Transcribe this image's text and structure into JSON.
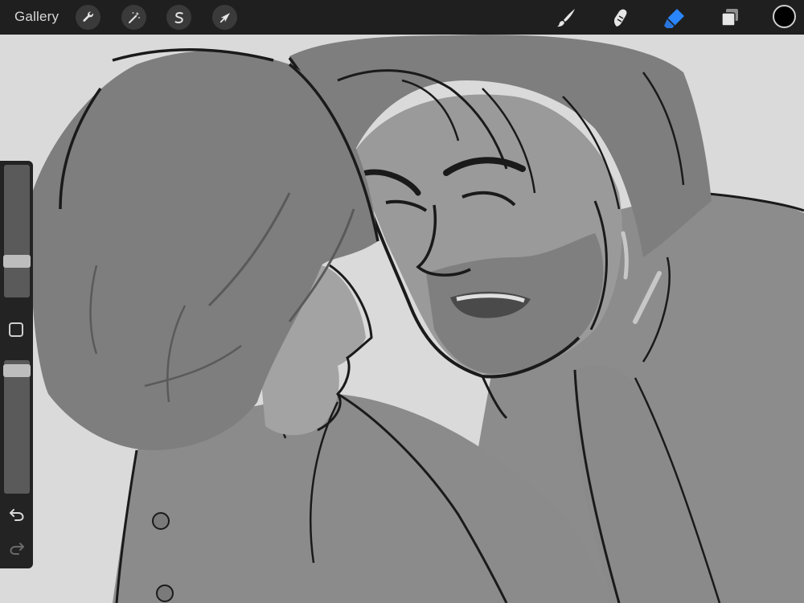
{
  "toolbar": {
    "gallery_label": "Gallery",
    "left_tools": [
      {
        "name": "actions",
        "icon": "wrench-icon"
      },
      {
        "name": "adjustments",
        "icon": "magic-wand-icon"
      },
      {
        "name": "selection",
        "icon": "selection-s-icon"
      },
      {
        "name": "transform",
        "icon": "arrow-cursor-icon"
      }
    ],
    "right_tools": [
      {
        "name": "brush",
        "icon": "brush-icon",
        "active": false
      },
      {
        "name": "smudge",
        "icon": "smudge-icon",
        "active": false
      },
      {
        "name": "eraser",
        "icon": "eraser-icon",
        "active": true
      },
      {
        "name": "layers",
        "icon": "layers-icon",
        "active": false
      }
    ],
    "current_color": "#000000",
    "accent_color": "#2a86ff"
  },
  "sidebar": {
    "brush_size_level": 0.25,
    "opacity_level": 0.97
  },
  "canvas": {
    "background_color": "#dadada",
    "artwork": "grayscale-sketch-two-figures"
  }
}
